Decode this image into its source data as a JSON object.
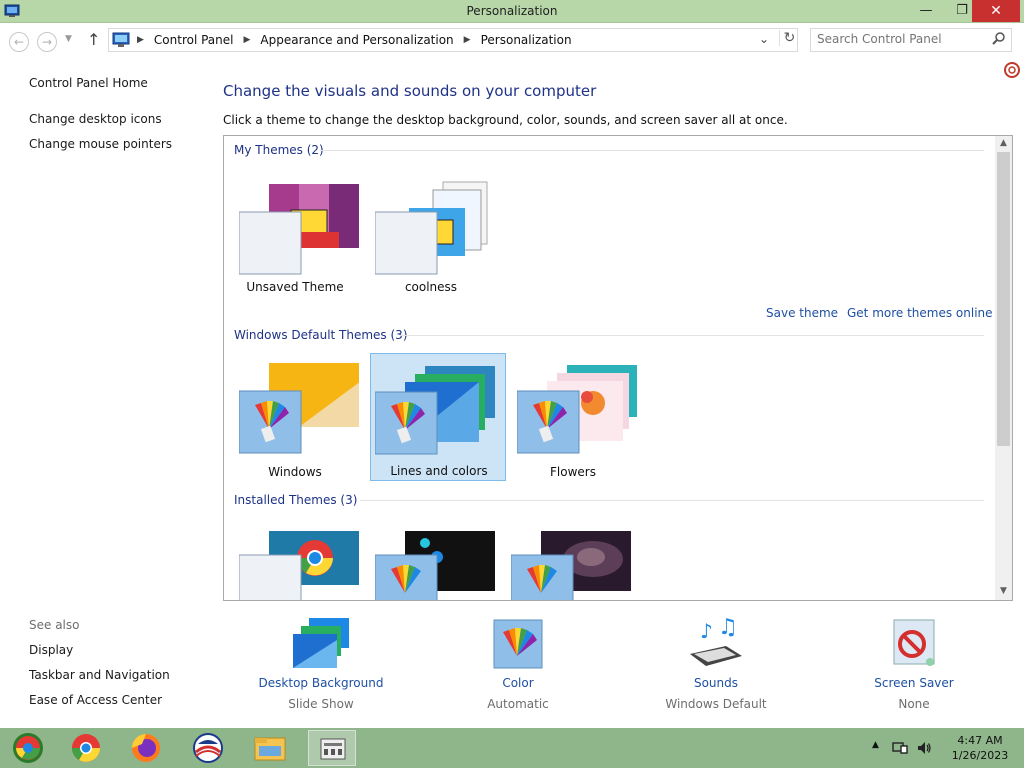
{
  "window": {
    "title": "Personalization",
    "controls": {
      "minimize": "—",
      "maximize": "❐",
      "close": "✕"
    }
  },
  "nav": {
    "back": "←",
    "forward": "→",
    "dropdown": "▼",
    "up": "↑",
    "breadcrumb": [
      "Control Panel",
      "Appearance and Personalization",
      "Personalization"
    ],
    "breadcrumb_sep": "▶",
    "address_dropdown": "⌄",
    "refresh": "↻",
    "search_placeholder": "Search Control Panel"
  },
  "left_pane": {
    "links": [
      "Control Panel Home",
      "Change desktop icons",
      "Change mouse pointers"
    ],
    "see_also_label": "See also",
    "see_also": [
      "Display",
      "Taskbar and Navigation",
      "Ease of Access Center"
    ]
  },
  "main": {
    "title": "Change the visuals and sounds on your computer",
    "description": "Click a theme to change the desktop background, color, sounds, and screen saver all at once."
  },
  "themes": {
    "my_themes_header": "My Themes (2)",
    "my_themes": [
      "Unsaved Theme",
      "coolness"
    ],
    "save_theme": "Save theme",
    "get_more": "Get more themes online",
    "windows_header": "Windows Default Themes (3)",
    "windows_themes": [
      "Windows",
      "Lines and colors",
      "Flowers"
    ],
    "selected": "Lines and colors",
    "installed_header": "Installed Themes (3)"
  },
  "settings": [
    {
      "name": "Desktop Background",
      "value": "Slide Show"
    },
    {
      "name": "Color",
      "value": "Automatic"
    },
    {
      "name": "Sounds",
      "value": "Windows Default"
    },
    {
      "name": "Screen Saver",
      "value": "None"
    }
  ],
  "taskbar": {
    "time": "4:47 AM",
    "date": "1/26/2023",
    "tray_chevron": "▲"
  },
  "colors": {
    "titlebar": "#b8d7a8",
    "close_button": "#c7302f",
    "heading_blue": "#1e3287",
    "link_blue": "#1e50a2",
    "taskbar": "#8fb58b",
    "selection": "#cde4f7"
  }
}
